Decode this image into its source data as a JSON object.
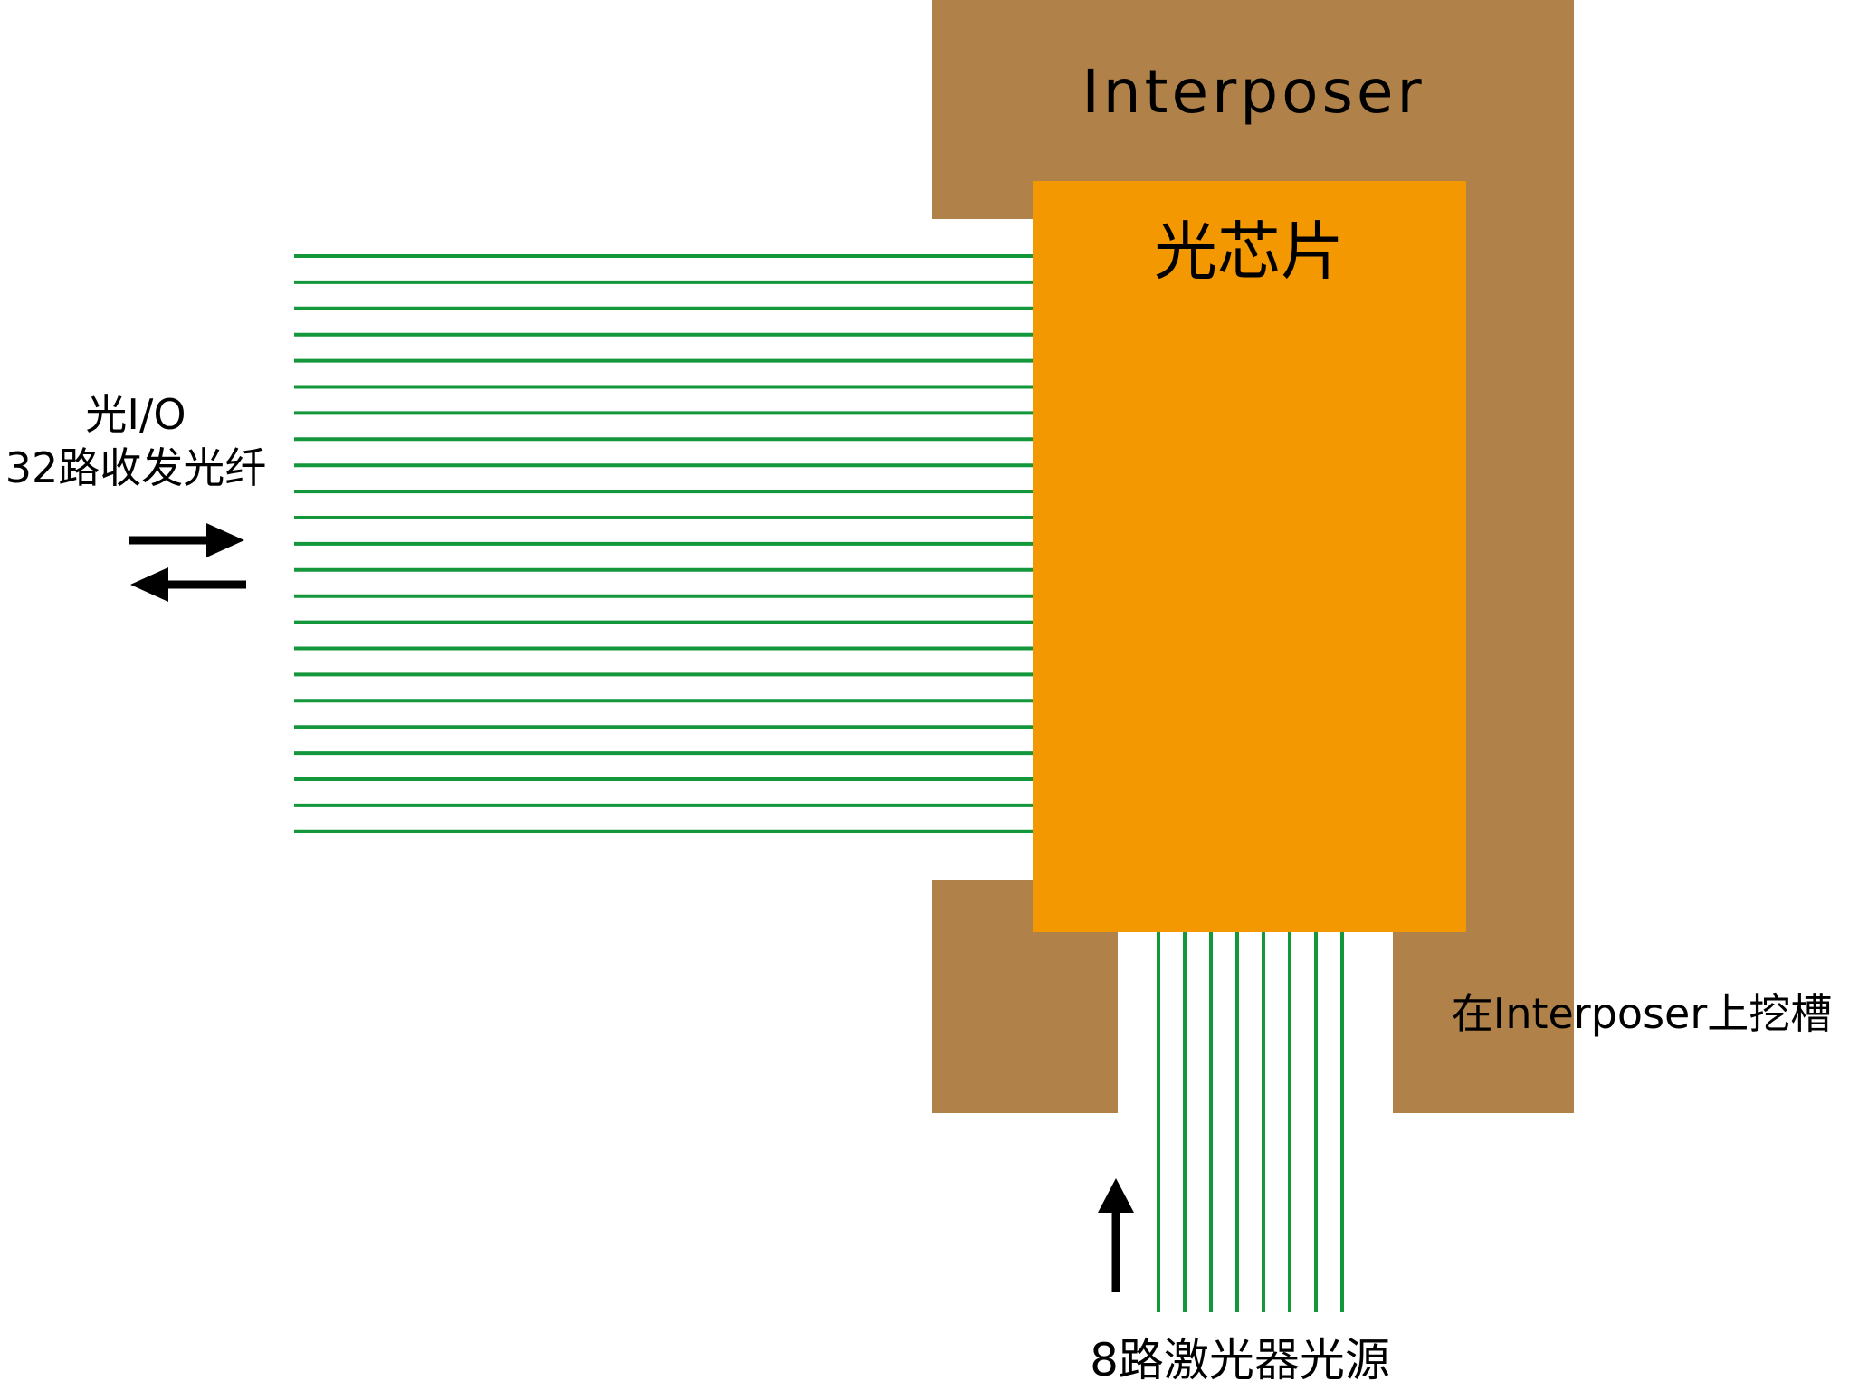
{
  "interposer": {
    "label": "Interposer",
    "color": "#b0824a"
  },
  "chip": {
    "label": "光芯片",
    "color": "#f39800"
  },
  "optical_io": {
    "label_line1": "光I/O",
    "label_line2": "32路收发光纤",
    "fiber_count": 23,
    "fiber_color": "#13973a",
    "arrow_icon": "bidirectional-arrow-icon"
  },
  "laser_source": {
    "label": "8路激光器光源",
    "fiber_count": 8,
    "fiber_color": "#13973a",
    "arrow_icon": "up-arrow-icon"
  },
  "groove": {
    "label": "在Interposer上挖槽"
  }
}
